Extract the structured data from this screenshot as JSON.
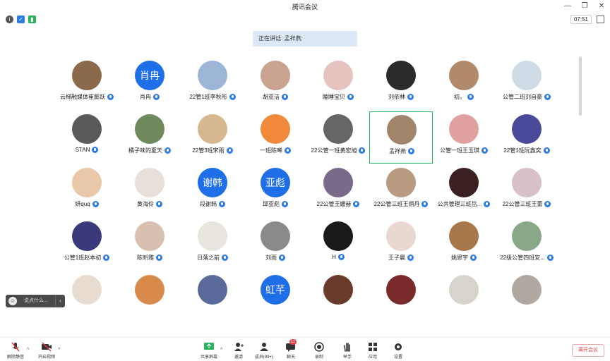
{
  "window": {
    "title": "腾讯会议",
    "clock": "07:51"
  },
  "speaker": {
    "text": "正在讲话: 孟祥燕;"
  },
  "participants": [
    {
      "name": "云梯融媒体崔膨跃",
      "avatar": "",
      "color": "#8a6a4a"
    },
    {
      "name": "肖冉",
      "avatar": "肖冉",
      "color": "#1e6fe8"
    },
    {
      "name": "22管1班李秋彤",
      "avatar": "",
      "color": "#9db6d8"
    },
    {
      "name": "胡亚洁",
      "avatar": "",
      "color": "#c9a390"
    },
    {
      "name": "瞌睡宝贝",
      "avatar": "",
      "color": "#e5c4c0"
    },
    {
      "name": "刘依林",
      "avatar": "",
      "color": "#2b2b2b"
    },
    {
      "name": "初。",
      "avatar": "",
      "color": "#b08a6a"
    },
    {
      "name": "公管二班刘自豪",
      "avatar": "",
      "color": "#cfdbe6"
    },
    {
      "name": "STAN",
      "avatar": "",
      "color": "#5a5a5a"
    },
    {
      "name": "橘子味的夏天",
      "avatar": "",
      "color": "#6e8a5a"
    },
    {
      "name": "22管3班宋雨",
      "avatar": "",
      "color": "#d6b890"
    },
    {
      "name": "一班陈晞",
      "avatar": "",
      "color": "#f08a3a"
    },
    {
      "name": "22公管一班黄宏旭",
      "avatar": "",
      "color": "#666666"
    },
    {
      "name": "孟祥燕",
      "avatar": "",
      "color": "#a0856a"
    },
    {
      "name": "公管一班王玉琪",
      "avatar": "",
      "color": "#e0a0a0"
    },
    {
      "name": "22管1班阮鑫奕",
      "avatar": "",
      "color": "#4a4a9a"
    },
    {
      "name": "妍quq",
      "avatar": "",
      "color": "#e8c8a8"
    },
    {
      "name": "黄海伶",
      "avatar": "",
      "color": "#e8e0d8"
    },
    {
      "name": "段谢韩",
      "avatar": "谢韩",
      "color": "#1e6fe8"
    },
    {
      "name": "邱亚彪",
      "avatar": "亚彪",
      "color": "#1e6fe8"
    },
    {
      "name": "22公管王媛赫",
      "avatar": "",
      "color": "#7a6a8a"
    },
    {
      "name": "22公管三班王炳丹",
      "avatar": "",
      "color": "#b89a80"
    },
    {
      "name": "公共管理三班岳...",
      "avatar": "",
      "color": "#3a2020"
    },
    {
      "name": "22公管三班王蕾",
      "avatar": "",
      "color": "#d8c0c8"
    },
    {
      "name": "公管1班赵本初",
      "avatar": "",
      "color": "#3a3a7a"
    },
    {
      "name": "陈昕雅",
      "avatar": "",
      "color": "#d8c0b0"
    },
    {
      "name": "日落之前",
      "avatar": "",
      "color": "#e8e4de"
    },
    {
      "name": "刘雨",
      "avatar": "",
      "color": "#8a8a8a"
    },
    {
      "name": "H",
      "avatar": "",
      "color": "#1a1a1a"
    },
    {
      "name": "王子晨",
      "avatar": "",
      "color": "#e8d8d0"
    },
    {
      "name": "姚思宇",
      "avatar": "",
      "color": "#a8784a"
    },
    {
      "name": "22级公管四班安...",
      "avatar": "",
      "color": "#88a888"
    },
    {
      "name": "",
      "avatar": "",
      "color": "#e8dcd0"
    },
    {
      "name": "",
      "avatar": "",
      "color": "#d88a4a"
    },
    {
      "name": "",
      "avatar": "",
      "color": "#5a6a9a"
    },
    {
      "name": "",
      "avatar": "虹芊",
      "color": "#1e6fe8"
    },
    {
      "name": "",
      "avatar": "",
      "color": "#6a3a2a"
    },
    {
      "name": "",
      "avatar": "",
      "color": "#7a2a2a"
    },
    {
      "name": "",
      "avatar": "",
      "color": "#d8d4cc"
    },
    {
      "name": "",
      "avatar": "",
      "color": "#b0a8a0"
    }
  ],
  "chat": {
    "placeholder": "说点什么..."
  },
  "toolbar": {
    "mute": "解除静音",
    "video": "开启视频",
    "share": "共享屏幕",
    "invite": "邀请",
    "members": "成员(99+)",
    "chat": "聊天",
    "chat_badge": "11",
    "record": "录制",
    "raise": "举手",
    "apps": "应用",
    "settings": "设置",
    "leave": "离开会议"
  }
}
